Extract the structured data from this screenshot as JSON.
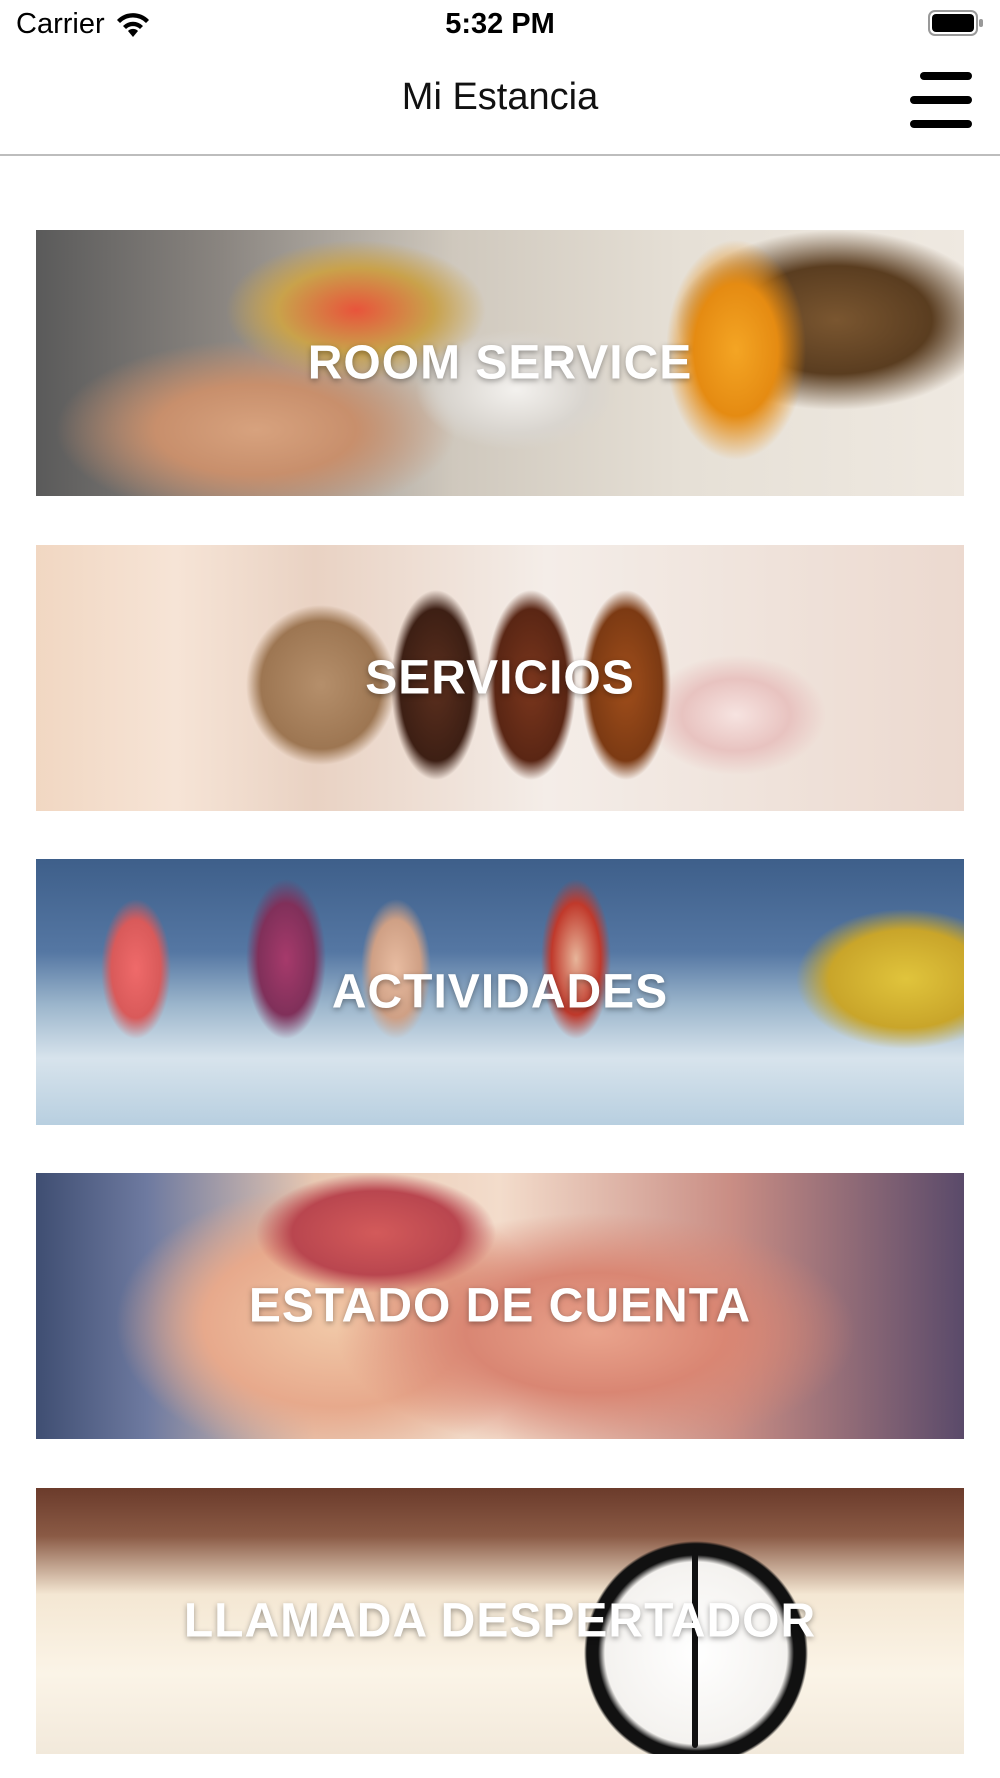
{
  "status_bar": {
    "carrier": "Carrier",
    "time": "5:32 PM",
    "wifi_icon": "wifi-icon",
    "battery_icon": "battery-icon"
  },
  "nav": {
    "title": "Mi Estancia",
    "menu_icon": "hamburger-menu-icon"
  },
  "cards": [
    {
      "label": "ROOM SERVICE"
    },
    {
      "label": "SERVICIOS"
    },
    {
      "label": "ACTIVIDADES"
    },
    {
      "label": "ESTADO DE CUENTA"
    },
    {
      "label": "LLAMADA DESPERTADOR"
    }
  ],
  "colors": {
    "label_text": "#ffffff",
    "nav_divider": "#bdbdbd",
    "background": "#ffffff"
  }
}
